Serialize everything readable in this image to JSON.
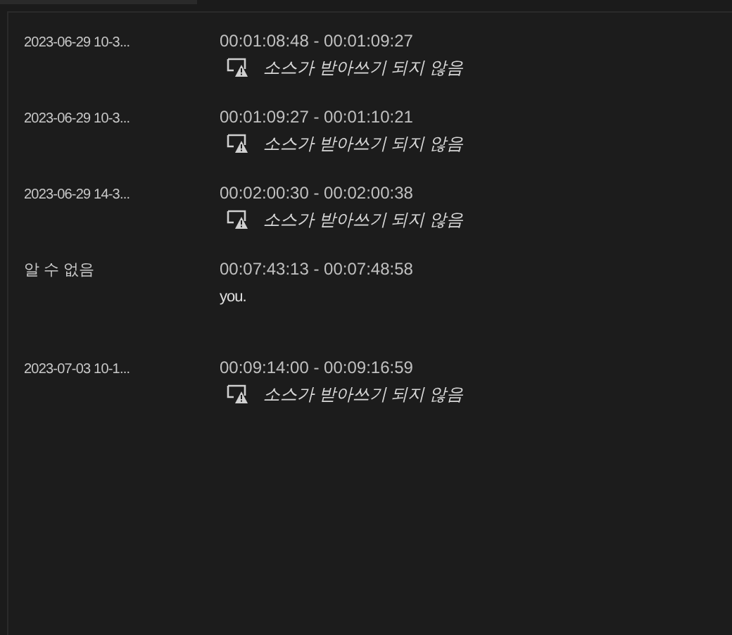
{
  "entries": [
    {
      "source": "2023-06-29 10-3...",
      "range": "00:01:08:48 - 00:01:09:27",
      "kind": "warning",
      "note": "소스가 받아쓰기 되지 않음"
    },
    {
      "source": "2023-06-29 10-3...",
      "range": "00:01:09:27 - 00:01:10:21",
      "kind": "warning",
      "note": "소스가 받아쓰기 되지 않음"
    },
    {
      "source": "2023-06-29 14-3...",
      "range": "00:02:00:30 - 00:02:00:38",
      "kind": "warning",
      "note": "소스가 받아쓰기 되지 않음"
    },
    {
      "source": "알 수 없음",
      "range": "00:07:43:13 - 00:07:48:58",
      "kind": "text",
      "note": "you."
    },
    {
      "source": "2023-07-03 10-1...",
      "range": "00:09:14:00 - 00:09:16:59",
      "kind": "warning",
      "note": "소스가 받아쓰기 되지 않음"
    }
  ]
}
